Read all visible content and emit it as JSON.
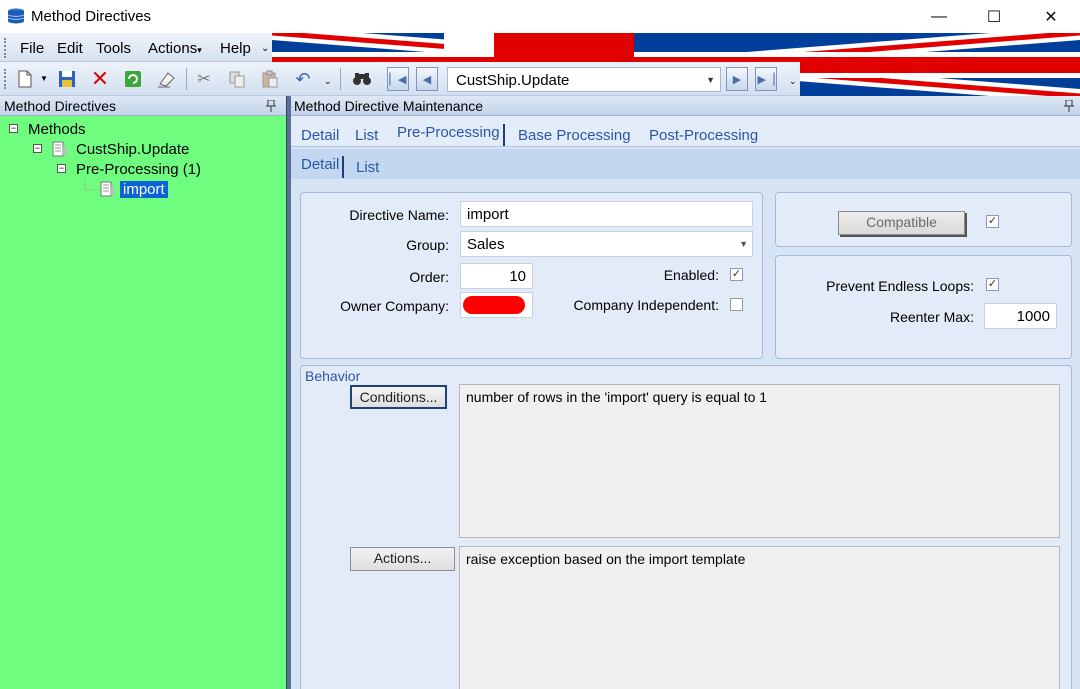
{
  "window": {
    "title": "Method Directives",
    "app_icon": "database-icon",
    "controls": {
      "minimize": "—",
      "maximize": "☐",
      "close": "✕"
    }
  },
  "menu": {
    "items": [
      "File",
      "Edit",
      "Tools",
      "Actions",
      "Help"
    ],
    "actions_arrow": "▾",
    "overflow": "⌄"
  },
  "toolbar": {
    "icons": [
      "new-document-icon",
      "save-icon",
      "delete-icon",
      "refresh-icon",
      "clear-icon",
      "cut-icon",
      "copy-icon",
      "paste-icon",
      "undo-icon",
      "find-icon"
    ],
    "nav_combo_value": "CustShip.Update",
    "overflow": "⌄"
  },
  "left_panel": {
    "title": "Method Directives",
    "pin": "📌",
    "background": "#6efd7f",
    "tree": [
      {
        "label": "Methods",
        "expander": "−"
      },
      {
        "label": "CustShip.Update",
        "expander": "−",
        "icon": "method-icon"
      },
      {
        "label": "Pre-Processing (1)",
        "expander": "−"
      },
      {
        "label": "import",
        "icon": "directive-icon",
        "selected": true
      }
    ]
  },
  "right_panel": {
    "title": "Method Directive Maintenance",
    "pin": "📌",
    "tabs": [
      "Detail",
      "List",
      "Pre-Processing",
      "Base Processing",
      "Post-Processing"
    ],
    "active_tab": "Pre-Processing",
    "subtabs": [
      "Detail",
      "List"
    ],
    "active_subtab": "Detail",
    "form": {
      "directive_name_label": "Directive Name:",
      "directive_name_value": "import",
      "group_label": "Group:",
      "group_value": "Sales",
      "order_label": "Order:",
      "order_value": "10",
      "enabled_label": "Enabled:",
      "enabled_checked": true,
      "owner_company_label": "Owner Company:",
      "company_independent_label": "Company Independent:",
      "company_independent_checked": false,
      "compatible_button": "Compatible",
      "compatible_checked": true,
      "prevent_loops_label": "Prevent Endless Loops:",
      "prevent_loops_checked": true,
      "reenter_max_label": "Reenter Max:",
      "reenter_max_value": "1000"
    },
    "behavior": {
      "title": "Behavior",
      "conditions_button": "Conditions...",
      "conditions_text": "number of rows in the 'import' query is equal to 1",
      "actions_button": "Actions...",
      "actions_text": "raise exception based on the import template"
    },
    "check_mark": "✓"
  },
  "colors": {
    "flag_blue": "#013f9a",
    "flag_red": "#e00000",
    "selection": "#0a64d6",
    "tab_text": "#2c56a5"
  }
}
